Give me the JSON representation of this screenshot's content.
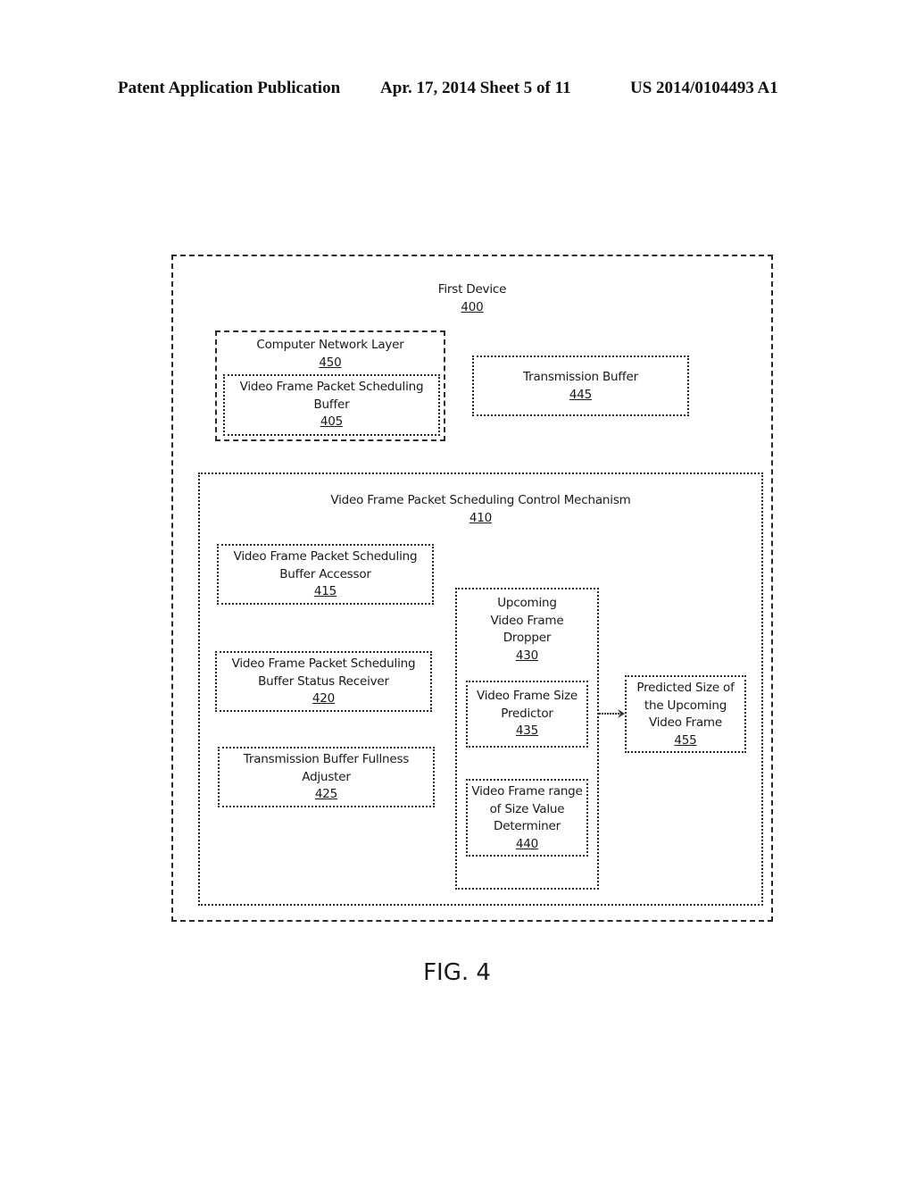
{
  "header": {
    "publication_type": "Patent Application Publication",
    "date_sheet": "Apr. 17, 2014  Sheet 5 of 11",
    "publication_number": "US 2014/0104493 A1"
  },
  "diagram": {
    "first_device": {
      "title": "First Device",
      "ref": "400"
    },
    "network_layer": {
      "title": "Computer Network Layer",
      "ref": "450"
    },
    "scheduling_buffer": {
      "lines": [
        "Video Frame Packet Scheduling",
        "Buffer"
      ],
      "ref": "405"
    },
    "transmission_buffer": {
      "title": "Transmission Buffer",
      "ref": "445"
    },
    "control_mechanism": {
      "title": "Video Frame Packet Scheduling Control Mechanism",
      "ref": "410"
    },
    "buffer_accessor": {
      "lines": [
        "Video Frame Packet Scheduling",
        "Buffer Accessor"
      ],
      "ref": "415"
    },
    "status_receiver": {
      "lines": [
        "Video Frame Packet Scheduling",
        "Buffer Status Receiver"
      ],
      "ref": "420"
    },
    "fullness_adjuster": {
      "lines": [
        "Transmission Buffer Fullness",
        "Adjuster"
      ],
      "ref": "425"
    },
    "frame_dropper": {
      "lines": [
        "Upcoming",
        "Video Frame",
        "Dropper"
      ],
      "ref": "430"
    },
    "size_predictor": {
      "lines": [
        "Video Frame Size",
        "Predictor"
      ],
      "ref": "435"
    },
    "range_determiner": {
      "lines": [
        "Video Frame range",
        "of Size Value",
        "Determiner"
      ],
      "ref": "440"
    },
    "predicted_size": {
      "lines": [
        "Predicted Size of",
        "the Upcoming",
        "Video Frame"
      ],
      "ref": "455"
    }
  },
  "figure_label": "FIG. 4"
}
